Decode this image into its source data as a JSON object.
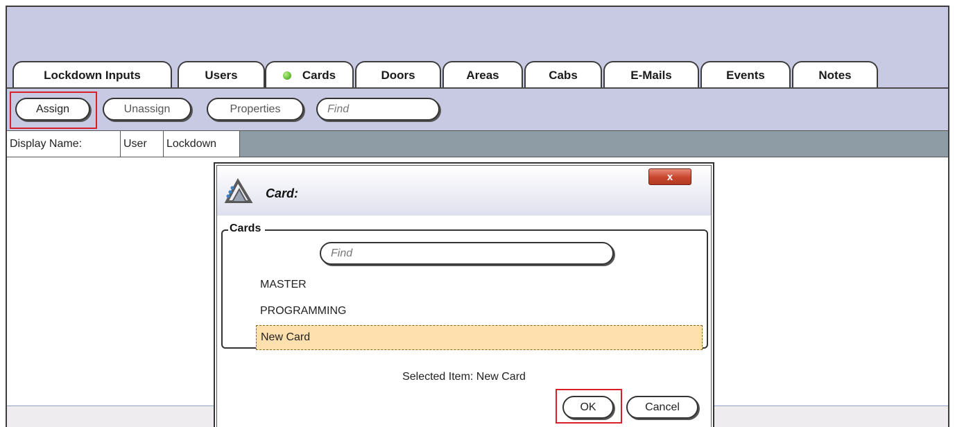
{
  "tabs": [
    {
      "label": "Lockdown Inputs"
    },
    {
      "label": "Users"
    },
    {
      "label": "Cards",
      "indicator": "green-status-dot"
    },
    {
      "label": "Doors"
    },
    {
      "label": "Areas"
    },
    {
      "label": "Cabs"
    },
    {
      "label": "E-Mails"
    },
    {
      "label": "Events"
    },
    {
      "label": "Notes"
    }
  ],
  "toolbar": {
    "assign_label": "Assign",
    "unassign_label": "Unassign",
    "properties_label": "Properties",
    "find_placeholder": "Find"
  },
  "columns": [
    {
      "label": "Display Name:"
    },
    {
      "label": "User"
    },
    {
      "label": "Lockdown"
    }
  ],
  "dialog": {
    "title": "Card:",
    "close_label": "x",
    "group_label": "Cards",
    "find_placeholder": "Find",
    "items": [
      {
        "label": "MASTER"
      },
      {
        "label": "PROGRAMMING"
      },
      {
        "label": "New Card",
        "selected": true
      }
    ],
    "selected_text": "Selected Item: New Card",
    "ok_label": "OK",
    "cancel_label": "Cancel"
  },
  "colors": {
    "accent_band": "#c8cae3",
    "highlight_box": "#d8202a",
    "selected_row": "#fde0ad",
    "close_button": "#c8452d",
    "column_bar": "#8e9ca6"
  }
}
